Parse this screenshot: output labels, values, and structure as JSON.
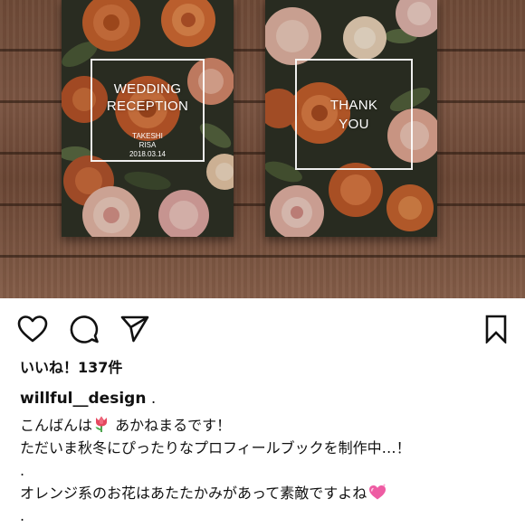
{
  "post": {
    "photo": {
      "left_card": {
        "title_line1": "WEDDING",
        "title_line2": "RECEPTION",
        "name1": "TAKESHI",
        "name2": "RISA",
        "date": "2018.03.14"
      },
      "right_card": {
        "title_line1": "THANK",
        "title_line2": "YOU"
      }
    },
    "actions": {
      "like_icon": "heart-outline-icon",
      "comment_icon": "comment-bubble-icon",
      "share_icon": "paper-plane-icon",
      "save_icon": "bookmark-outline-icon"
    },
    "likes_text": "いいね！137件",
    "username": "willful__design",
    "username_suffix": " .",
    "caption": {
      "line1_before": "こんばんは",
      "line1_after": " あかねまるです！",
      "line2": "ただいま秋冬にぴったりなプロフィールブックを制作中…！",
      "line3": ".",
      "line4": "オレンジ系のお花はあたたかみがあって素敵ですよね",
      "line5": "."
    },
    "emoji": {
      "tulip": "tulip-emoji",
      "heart": "pink-sparkling-heart-emoji"
    }
  }
}
